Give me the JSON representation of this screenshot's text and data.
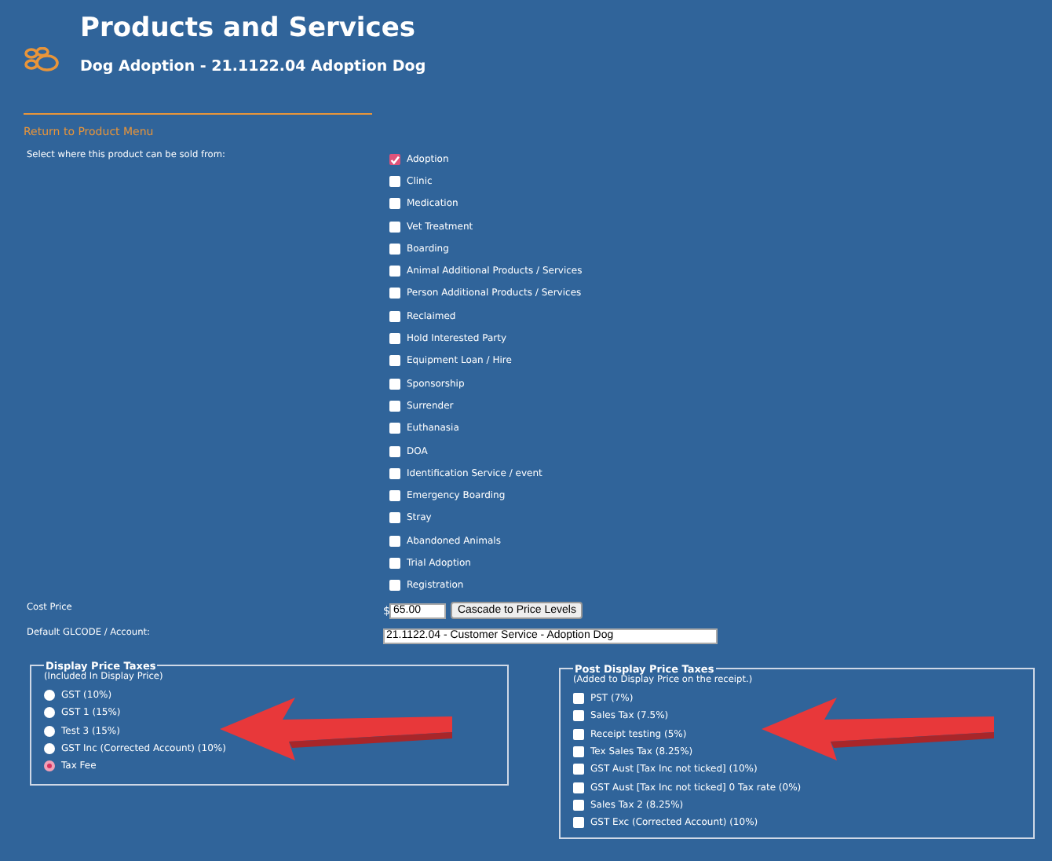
{
  "header": {
    "title": "Products and Services",
    "subtitle": "Dog Adoption - 21.1122.04 Adoption Dog"
  },
  "back_link": "Return to Product Menu",
  "sold_from": {
    "label": "Select where this product can be sold from:",
    "options": [
      {
        "label": "Adoption",
        "checked": true
      },
      {
        "label": "Clinic",
        "checked": false
      },
      {
        "label": "Medication",
        "checked": false
      },
      {
        "label": "Vet Treatment",
        "checked": false
      },
      {
        "label": "Boarding",
        "checked": false
      },
      {
        "label": "Animal Additional Products / Services",
        "checked": false
      },
      {
        "label": "Person Additional Products / Services",
        "checked": false
      },
      {
        "label": "Reclaimed",
        "checked": false
      },
      {
        "label": "Hold Interested Party",
        "checked": false
      },
      {
        "label": "Equipment Loan / Hire",
        "checked": false
      },
      {
        "label": "Sponsorship",
        "checked": false
      },
      {
        "label": "Surrender",
        "checked": false
      },
      {
        "label": "Euthanasia",
        "checked": false
      },
      {
        "label": "DOA",
        "checked": false
      },
      {
        "label": "Identification Service / event",
        "checked": false
      },
      {
        "label": "Emergency Boarding",
        "checked": false
      },
      {
        "label": "Stray",
        "checked": false
      },
      {
        "label": "Abandoned Animals",
        "checked": false
      },
      {
        "label": "Trial Adoption",
        "checked": false
      },
      {
        "label": "Registration",
        "checked": false
      }
    ]
  },
  "cost_price": {
    "label": "Cost Price",
    "currency": "$",
    "value": "65.00",
    "button": "Cascade to Price Levels"
  },
  "gl_code": {
    "label": "Default GLCODE / Account:",
    "value": "21.1122.04 - Customer Service - Adoption Dog"
  },
  "display_taxes": {
    "legend": "Display Price Taxes",
    "note": "(Included In Display Price)",
    "options": [
      {
        "label": "GST (10%)",
        "selected": false
      },
      {
        "label": "GST 1 (15%)",
        "selected": false
      },
      {
        "label": "Test 3 (15%)",
        "selected": false
      },
      {
        "label": "GST Inc (Corrected Account) (10%)",
        "selected": false
      },
      {
        "label": "Tax Fee",
        "selected": true
      }
    ]
  },
  "post_display_taxes": {
    "legend": "Post Display Price Taxes",
    "note": "(Added to Display Price on the receipt.)",
    "options": [
      {
        "label": "PST (7%)",
        "checked": false
      },
      {
        "label": "Sales Tax (7.5%)",
        "checked": false
      },
      {
        "label": "Receipt testing (5%)",
        "checked": false
      },
      {
        "label": "Tex Sales Tax  (8.25%)",
        "checked": false
      },
      {
        "label": "GST Aust [Tax Inc not ticked] (10%)",
        "checked": false
      },
      {
        "label": "GST Aust [Tax Inc not ticked] 0 Tax rate (0%)",
        "checked": false
      },
      {
        "label": "Sales Tax 2 (8.25%)",
        "checked": false
      },
      {
        "label": "GST Exc (Corrected Account) (10%)",
        "checked": false
      }
    ]
  }
}
